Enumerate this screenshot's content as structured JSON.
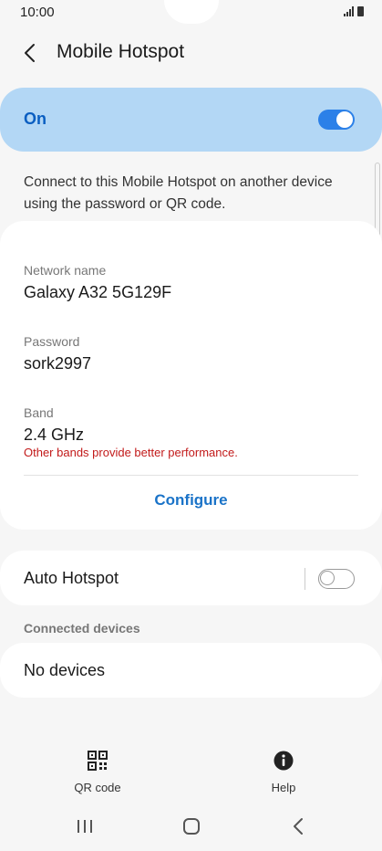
{
  "status_bar": {
    "time": "10:00"
  },
  "header": {
    "title": "Mobile Hotspot"
  },
  "master_switch": {
    "label": "On",
    "state": "on"
  },
  "description": "Connect to this Mobile Hotspot on another device using the password or QR code.",
  "settings": {
    "network_name_label": "Network name",
    "network_name": "Galaxy A32 5G129F",
    "password_label": "Password",
    "password": "sork2997",
    "band_label": "Band",
    "band": "2.4 GHz",
    "band_warning": "Other bands provide better performance.",
    "configure_label": "Configure"
  },
  "auto_hotspot": {
    "label": "Auto Hotspot",
    "state": "off"
  },
  "connected_devices": {
    "header": "Connected devices",
    "empty_text": "No devices"
  },
  "bottom_actions": [
    {
      "label": "QR code",
      "icon": "qr-code-icon"
    },
    {
      "label": "Help",
      "icon": "info-icon"
    }
  ],
  "colors": {
    "accent": "#2b80e8",
    "master_bg": "#b3d7f5",
    "warning": "#c21a1a",
    "link": "#1a73c8"
  }
}
